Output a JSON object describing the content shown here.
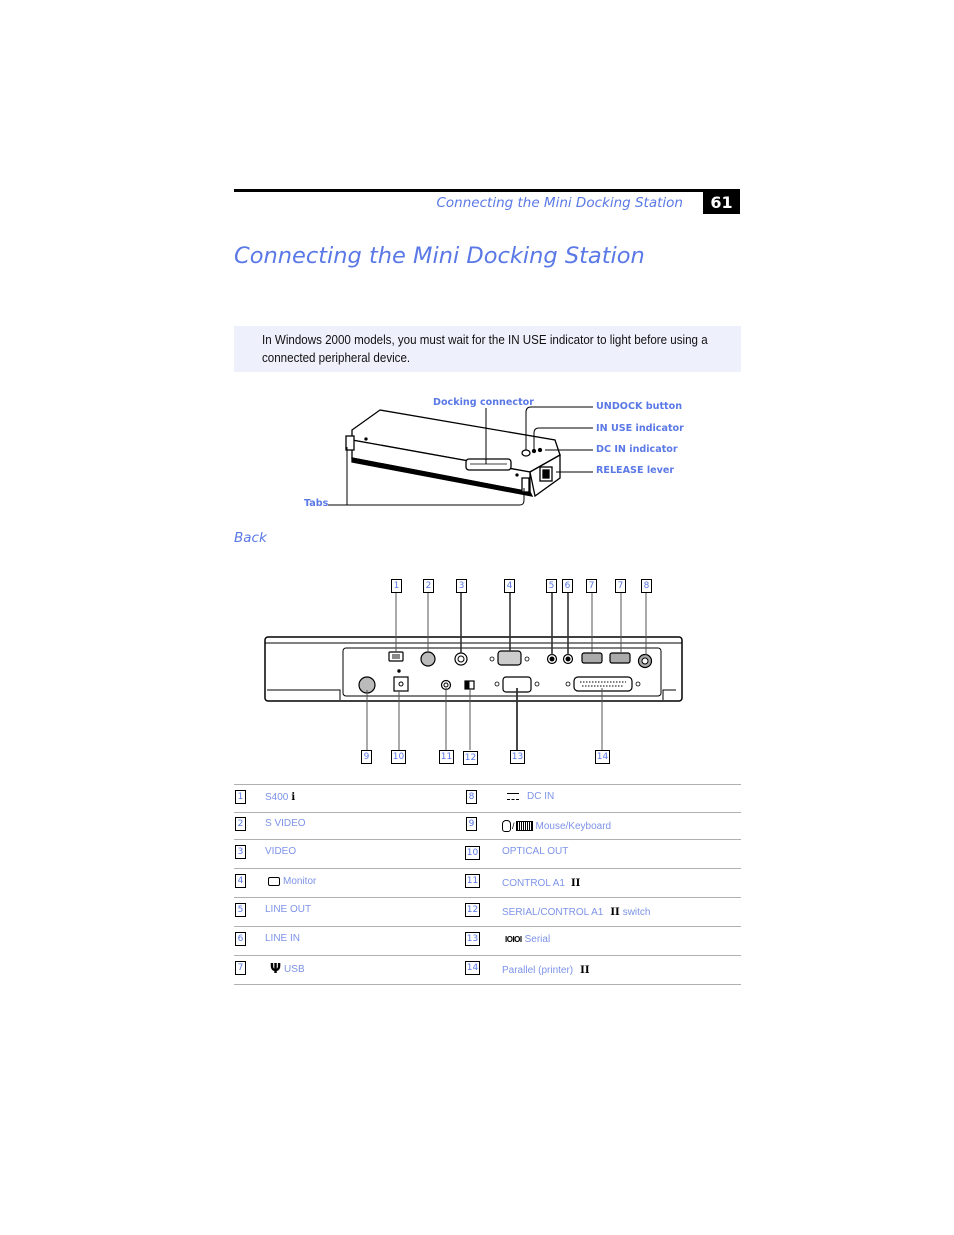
{
  "header": {
    "running_title": "Connecting the Mini Docking Station",
    "page_number": "61"
  },
  "page_title": "Connecting the Mini Docking Station",
  "note": {
    "text": "In Windows 2000 models, you must wait for the IN USE indicator to light before using a connected peripheral device."
  },
  "top_figure": {
    "callouts": {
      "docking_connector": "Docking connector",
      "undock_button": "UNDOCK button",
      "in_use_indicator": "IN USE indicator",
      "dc_in_indicator": "DC IN indicator",
      "release_lever": "RELEASE lever",
      "tabs": "Tabs"
    }
  },
  "back_section": {
    "heading": "Back",
    "top_numbers": [
      "1",
      "2",
      "3",
      "4",
      "5",
      "6",
      "7",
      "7",
      "8"
    ],
    "bottom_numbers": [
      "9",
      "10",
      "11",
      "12",
      "13",
      "14"
    ]
  },
  "legend": {
    "left": [
      {
        "num": "1",
        "label": "S400",
        "icon": "i-link-icon"
      },
      {
        "num": "2",
        "label": "S VIDEO",
        "icon": ""
      },
      {
        "num": "3",
        "label": "VIDEO",
        "icon": ""
      },
      {
        "num": "4",
        "label": "Monitor",
        "icon": "monitor-icon"
      },
      {
        "num": "5",
        "label": "LINE OUT",
        "icon": ""
      },
      {
        "num": "6",
        "label": "LINE IN",
        "icon": ""
      },
      {
        "num": "7",
        "label": "USB",
        "icon": "usb-icon"
      }
    ],
    "right": [
      {
        "num": "8",
        "label": "DC IN",
        "icon": "dc-icon"
      },
      {
        "num": "9",
        "label": "Mouse/Keyboard",
        "icon": "mouse-keyboard-icon"
      },
      {
        "num": "10",
        "label": "OPTICAL OUT",
        "icon": ""
      },
      {
        "num": "11",
        "label": "CONTROL A1",
        "suffix_glyph": "II",
        "icon": ""
      },
      {
        "num": "12",
        "label": "SERIAL/CONTROL A1",
        "suffix_glyph": "II",
        "suffix_text": "switch",
        "icon": ""
      },
      {
        "num": "13",
        "label": "Serial",
        "icon": "serial-icon"
      },
      {
        "num": "14",
        "label": "Parallel (printer)",
        "suffix_glyph": "II",
        "icon": ""
      }
    ]
  }
}
